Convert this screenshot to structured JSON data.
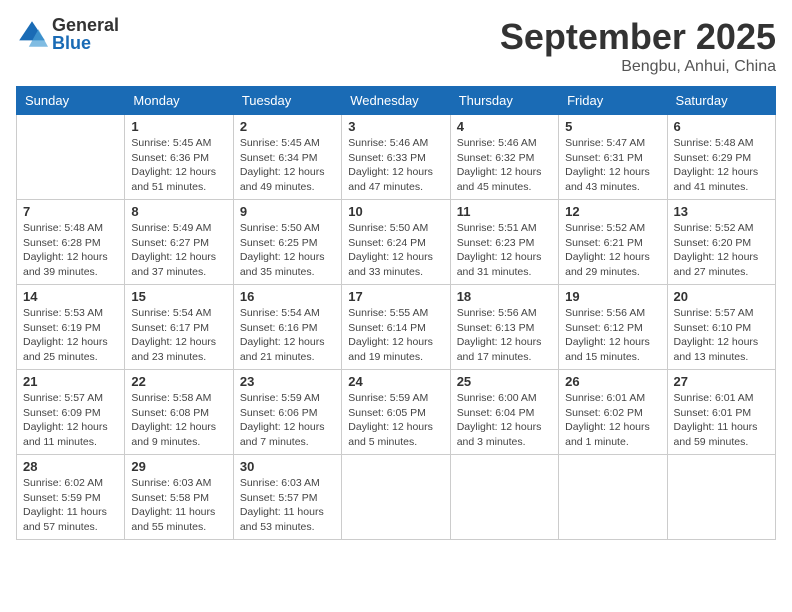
{
  "header": {
    "logo_general": "General",
    "logo_blue": "Blue",
    "month": "September 2025",
    "location": "Bengbu, Anhui, China"
  },
  "weekdays": [
    "Sunday",
    "Monday",
    "Tuesday",
    "Wednesday",
    "Thursday",
    "Friday",
    "Saturday"
  ],
  "weeks": [
    [
      {
        "day": "",
        "info": ""
      },
      {
        "day": "1",
        "info": "Sunrise: 5:45 AM\nSunset: 6:36 PM\nDaylight: 12 hours\nand 51 minutes."
      },
      {
        "day": "2",
        "info": "Sunrise: 5:45 AM\nSunset: 6:34 PM\nDaylight: 12 hours\nand 49 minutes."
      },
      {
        "day": "3",
        "info": "Sunrise: 5:46 AM\nSunset: 6:33 PM\nDaylight: 12 hours\nand 47 minutes."
      },
      {
        "day": "4",
        "info": "Sunrise: 5:46 AM\nSunset: 6:32 PM\nDaylight: 12 hours\nand 45 minutes."
      },
      {
        "day": "5",
        "info": "Sunrise: 5:47 AM\nSunset: 6:31 PM\nDaylight: 12 hours\nand 43 minutes."
      },
      {
        "day": "6",
        "info": "Sunrise: 5:48 AM\nSunset: 6:29 PM\nDaylight: 12 hours\nand 41 minutes."
      }
    ],
    [
      {
        "day": "7",
        "info": "Sunrise: 5:48 AM\nSunset: 6:28 PM\nDaylight: 12 hours\nand 39 minutes."
      },
      {
        "day": "8",
        "info": "Sunrise: 5:49 AM\nSunset: 6:27 PM\nDaylight: 12 hours\nand 37 minutes."
      },
      {
        "day": "9",
        "info": "Sunrise: 5:50 AM\nSunset: 6:25 PM\nDaylight: 12 hours\nand 35 minutes."
      },
      {
        "day": "10",
        "info": "Sunrise: 5:50 AM\nSunset: 6:24 PM\nDaylight: 12 hours\nand 33 minutes."
      },
      {
        "day": "11",
        "info": "Sunrise: 5:51 AM\nSunset: 6:23 PM\nDaylight: 12 hours\nand 31 minutes."
      },
      {
        "day": "12",
        "info": "Sunrise: 5:52 AM\nSunset: 6:21 PM\nDaylight: 12 hours\nand 29 minutes."
      },
      {
        "day": "13",
        "info": "Sunrise: 5:52 AM\nSunset: 6:20 PM\nDaylight: 12 hours\nand 27 minutes."
      }
    ],
    [
      {
        "day": "14",
        "info": "Sunrise: 5:53 AM\nSunset: 6:19 PM\nDaylight: 12 hours\nand 25 minutes."
      },
      {
        "day": "15",
        "info": "Sunrise: 5:54 AM\nSunset: 6:17 PM\nDaylight: 12 hours\nand 23 minutes."
      },
      {
        "day": "16",
        "info": "Sunrise: 5:54 AM\nSunset: 6:16 PM\nDaylight: 12 hours\nand 21 minutes."
      },
      {
        "day": "17",
        "info": "Sunrise: 5:55 AM\nSunset: 6:14 PM\nDaylight: 12 hours\nand 19 minutes."
      },
      {
        "day": "18",
        "info": "Sunrise: 5:56 AM\nSunset: 6:13 PM\nDaylight: 12 hours\nand 17 minutes."
      },
      {
        "day": "19",
        "info": "Sunrise: 5:56 AM\nSunset: 6:12 PM\nDaylight: 12 hours\nand 15 minutes."
      },
      {
        "day": "20",
        "info": "Sunrise: 5:57 AM\nSunset: 6:10 PM\nDaylight: 12 hours\nand 13 minutes."
      }
    ],
    [
      {
        "day": "21",
        "info": "Sunrise: 5:57 AM\nSunset: 6:09 PM\nDaylight: 12 hours\nand 11 minutes."
      },
      {
        "day": "22",
        "info": "Sunrise: 5:58 AM\nSunset: 6:08 PM\nDaylight: 12 hours\nand 9 minutes."
      },
      {
        "day": "23",
        "info": "Sunrise: 5:59 AM\nSunset: 6:06 PM\nDaylight: 12 hours\nand 7 minutes."
      },
      {
        "day": "24",
        "info": "Sunrise: 5:59 AM\nSunset: 6:05 PM\nDaylight: 12 hours\nand 5 minutes."
      },
      {
        "day": "25",
        "info": "Sunrise: 6:00 AM\nSunset: 6:04 PM\nDaylight: 12 hours\nand 3 minutes."
      },
      {
        "day": "26",
        "info": "Sunrise: 6:01 AM\nSunset: 6:02 PM\nDaylight: 12 hours\nand 1 minute."
      },
      {
        "day": "27",
        "info": "Sunrise: 6:01 AM\nSunset: 6:01 PM\nDaylight: 11 hours\nand 59 minutes."
      }
    ],
    [
      {
        "day": "28",
        "info": "Sunrise: 6:02 AM\nSunset: 5:59 PM\nDaylight: 11 hours\nand 57 minutes."
      },
      {
        "day": "29",
        "info": "Sunrise: 6:03 AM\nSunset: 5:58 PM\nDaylight: 11 hours\nand 55 minutes."
      },
      {
        "day": "30",
        "info": "Sunrise: 6:03 AM\nSunset: 5:57 PM\nDaylight: 11 hours\nand 53 minutes."
      },
      {
        "day": "",
        "info": ""
      },
      {
        "day": "",
        "info": ""
      },
      {
        "day": "",
        "info": ""
      },
      {
        "day": "",
        "info": ""
      }
    ]
  ]
}
